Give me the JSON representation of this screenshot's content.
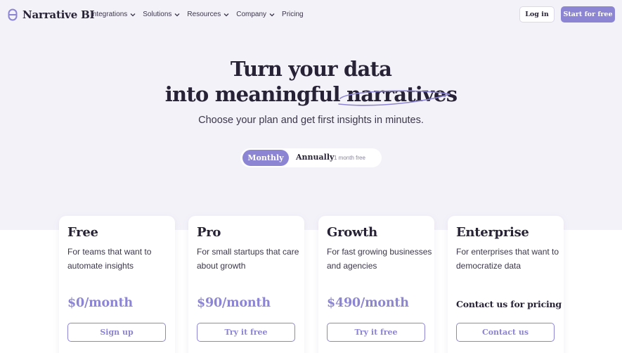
{
  "nav": {
    "brand": "Narrative BI",
    "links": [
      {
        "label": "Integrations",
        "dropdown": true
      },
      {
        "label": "Solutions",
        "dropdown": true
      },
      {
        "label": "Resources",
        "dropdown": true
      },
      {
        "label": "Company",
        "dropdown": true
      },
      {
        "label": "Pricing",
        "dropdown": false
      }
    ],
    "login_label": "Log in",
    "start_label": "Start for free"
  },
  "hero": {
    "line1": "Turn your data",
    "line2_prefix": "into meaningful",
    "line2_highlight": "narratives",
    "subtitle": "Choose your plan and get first insights in minutes."
  },
  "billing_toggle": {
    "monthly": "Monthly",
    "annually": "Annually",
    "annual_badge": "1 month free",
    "selected": "Monthly"
  },
  "plans": [
    {
      "name": "Free",
      "description": "For teams that want to automate insights",
      "price": "$0/month",
      "cta": "Sign up"
    },
    {
      "name": "Pro",
      "description": "For small startups that care about growth",
      "price": "$90/month",
      "cta": "Try it free"
    },
    {
      "name": "Growth",
      "description": "For fast growing businesses and agencies",
      "price": "$490/month",
      "cta": "Try it free"
    },
    {
      "name": "Enterprise",
      "description": "For enterprises that want to democratize data",
      "price": "Contact us for pricing",
      "cta": "Contact us"
    }
  ],
  "colors": {
    "accent": "#8c85d3",
    "text": "#272235",
    "hero_bg": "#f4f2f9"
  }
}
